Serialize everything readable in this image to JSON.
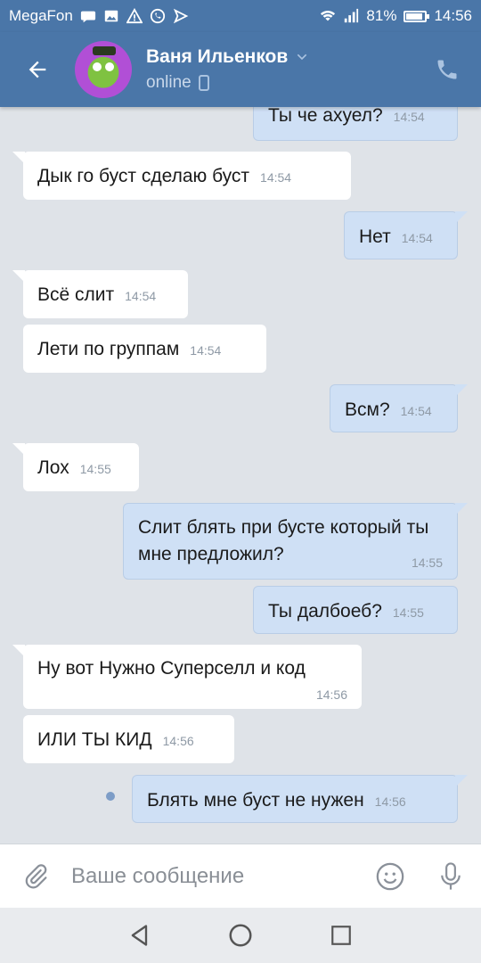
{
  "status_bar": {
    "carrier": "MegaFon",
    "battery": "81%",
    "time": "14:56"
  },
  "header": {
    "name": "Ваня Ильенков",
    "status": "online"
  },
  "messages": [
    {
      "dir": "out",
      "text": "Ты че ахуел?",
      "time": "14:54"
    },
    {
      "dir": "in",
      "text": "Дык го буст сделаю буст",
      "time": "14:54"
    },
    {
      "dir": "out",
      "text": "Нет",
      "time": "14:54"
    },
    {
      "dir": "in",
      "text": "Всё слит",
      "time": "14:54"
    },
    {
      "dir": "in",
      "text": "Лети по группам",
      "time": "14:54"
    },
    {
      "dir": "out",
      "text": "Всм?",
      "time": "14:54"
    },
    {
      "dir": "in",
      "text": "Лох",
      "time": "14:55"
    },
    {
      "dir": "out",
      "text": "Слит блять при бусте который ты мне предложил?",
      "time": "14:55"
    },
    {
      "dir": "out",
      "text": "Ты далбоеб?",
      "time": "14:55"
    },
    {
      "dir": "in",
      "text": "Ну вот Нужно Суперселл и код",
      "time": "14:56"
    },
    {
      "dir": "in",
      "text": "ИЛИ ТЫ КИД",
      "time": "14:56"
    },
    {
      "dir": "out",
      "text": "Блять мне буст не нужен",
      "time": "14:56"
    }
  ],
  "composer": {
    "placeholder": "Ваше сообщение"
  },
  "colors": {
    "header_bg": "#4a76a8",
    "chat_bg": "#dfe3e8",
    "bubble_in": "#ffffff",
    "bubble_out": "#cfe0f5"
  }
}
